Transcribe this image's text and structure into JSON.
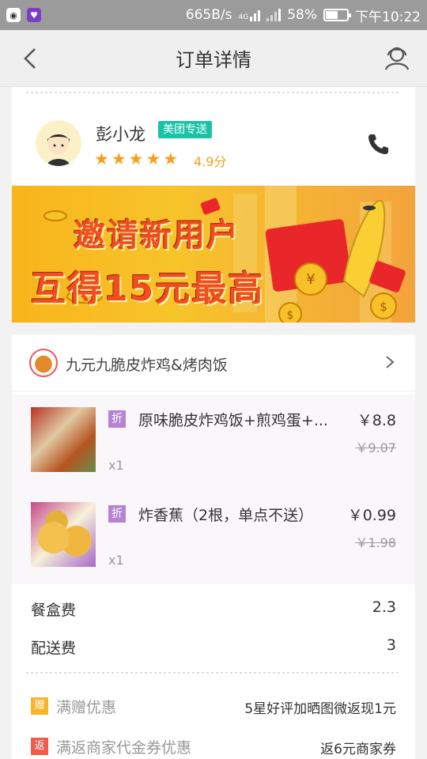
{
  "statusbar": {
    "app_icon_1": "qq-icon",
    "app_icon_2": "shield-icon",
    "speed": "665B/s",
    "network": "4G",
    "battery": "58%",
    "battery_level": 0.58,
    "time": "下午10:22"
  },
  "navbar": {
    "title": "订单详情"
  },
  "rider": {
    "name": "彭小龙",
    "badge": "美团专送",
    "stars": 5,
    "rating": "4.9分"
  },
  "banner": {
    "line1": "邀请新用户",
    "line2": "互得15元最高"
  },
  "shop": {
    "name": "九元九脆皮炸鸡&烤肉饭"
  },
  "items": [
    {
      "tag": "折",
      "name": "原味脆皮炸鸡饭+煎鸡蛋+...",
      "qty": "x1",
      "price": "￥8.8",
      "original_price": "￥9.07"
    },
    {
      "tag": "折",
      "name": "炸香蕉（2根，单点不送）",
      "qty": "x1",
      "price": "￥0.99",
      "original_price": "￥1.98"
    }
  ],
  "fees": [
    {
      "label": "餐盒费",
      "value": "2.3"
    },
    {
      "label": "配送费",
      "value": "3"
    }
  ],
  "discounts": [
    {
      "icon": "赠",
      "label": "满赠优惠",
      "value": "5星好评加晒图微返现1元",
      "color": "#f7b52b"
    },
    {
      "icon": "返",
      "label": "满返商家代金券优惠",
      "value": "返6元商家券",
      "color": "#f05b4b"
    }
  ],
  "colors": {
    "accent": "#19c4a6",
    "star": "#f7a01b",
    "discount_tag": "#b683d4"
  }
}
